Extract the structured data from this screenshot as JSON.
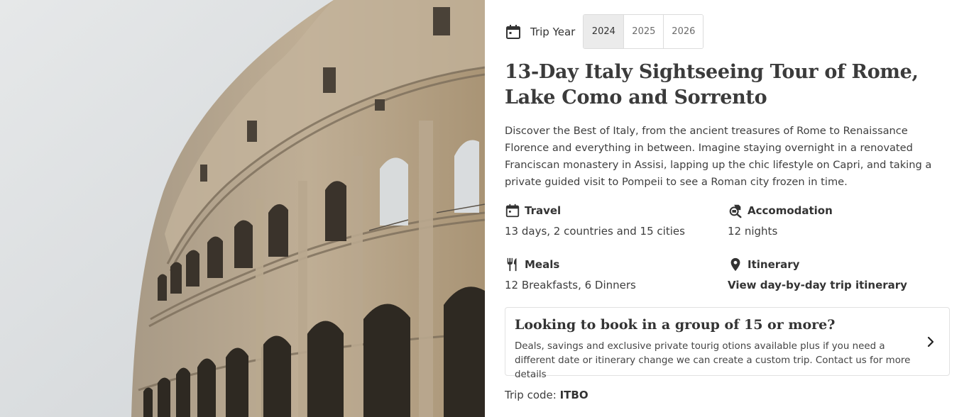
{
  "hero": {
    "image_alt": "Colosseum in Rome",
    "icon": "colosseum-photo"
  },
  "year_picker": {
    "label": "Trip Year",
    "icon": "calendar-icon",
    "years": [
      "2024",
      "2025",
      "2026"
    ],
    "selected": "2024"
  },
  "title": "13-Day Italy Sightseeing Tour of Rome, Lake Como and Sorrento",
  "description": "Discover the Best of Italy, from the ancient treasures of Rome to Renaissance Florence and everything in between. Imagine staying overnight in a renovated Franciscan monastery in Assisi, lapping up the chic lifestyle on Capri, and taking a private guided visit to Pompeii to see a Roman city frozen in time.",
  "features": {
    "travel": {
      "title": "Travel",
      "value": "13 days, 2 countries and 15 cities",
      "icon": "calendar-icon"
    },
    "accomodation": {
      "title": "Accomodation",
      "value": "12 nights",
      "icon": "hotel-search-icon"
    },
    "meals": {
      "title": "Meals",
      "value": "12 Breakfasts, 6 Dinners",
      "icon": "fork-knife-icon"
    },
    "itinerary": {
      "title": "Itinerary",
      "link": "View day-by-day trip itinerary",
      "icon": "map-pin-icon"
    }
  },
  "group_booking": {
    "title": "Looking to book in a group of 15 or more?",
    "text": "Deals, savings and exclusive private tourig otions available plus if you need a different date or itinerary change we can create a custom trip. Contact us for more details",
    "icon": "chevron-right-icon"
  },
  "trip_code": {
    "label": "Trip code:",
    "value": "ITBO"
  },
  "colors": {
    "text": "#333333",
    "border": "#e1e1e1",
    "selected_year_bg": "#ebebeb",
    "stone": "#b8a58a",
    "sky": "#dfe2e4"
  }
}
